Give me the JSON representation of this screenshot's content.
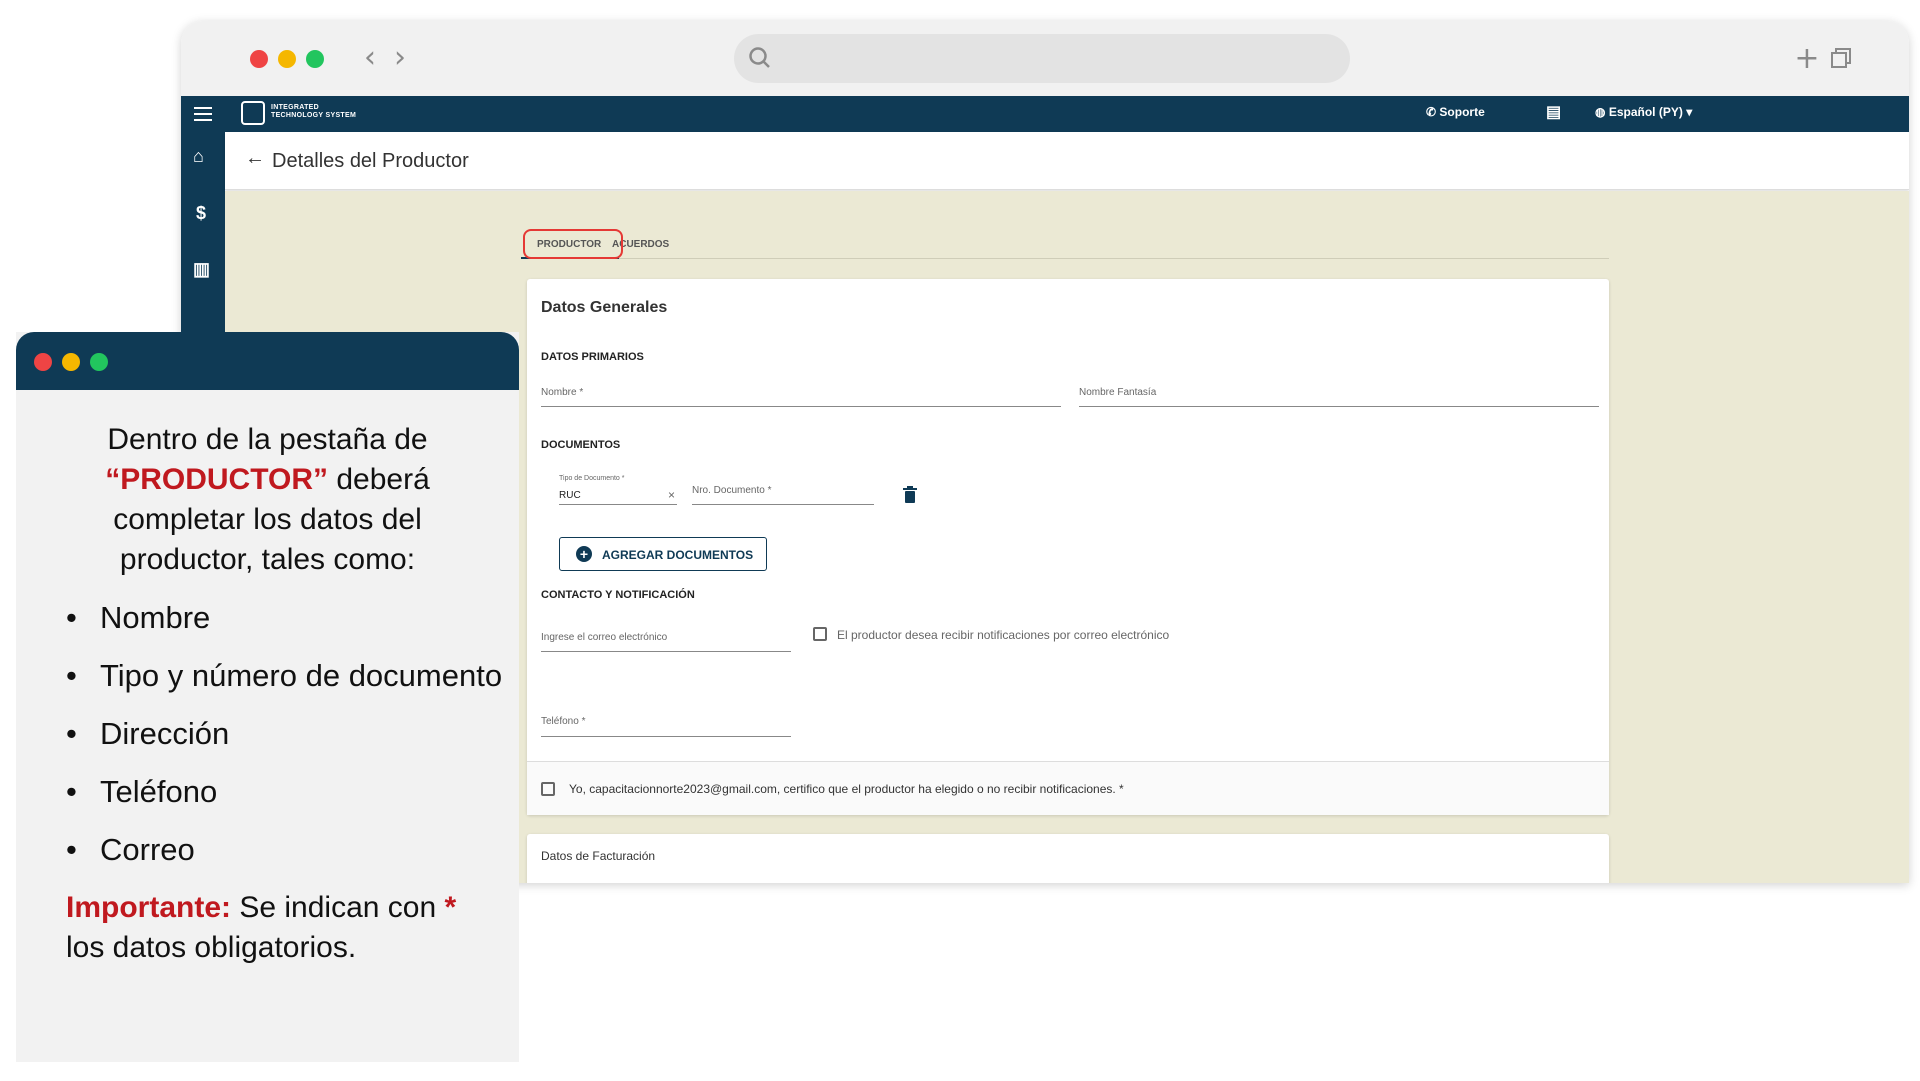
{
  "browser": {
    "traffic_lights": [
      "#ef4444",
      "#f5b700",
      "#22c55e"
    ],
    "nav_back": "‹",
    "nav_forward": "›",
    "new_tab": "+",
    "tab_overview_icon": "tabs-icon"
  },
  "appbar": {
    "brand_line1": "INTEGRATED",
    "brand_line2": "TECHNOLOGY SYSTEM",
    "support_label": "Soporte",
    "language_label": "Español (PY)",
    "background_color": "#0f3a55"
  },
  "rail": {
    "icons": [
      "menu-icon",
      "home-icon",
      "dollar-icon",
      "chart-icon"
    ]
  },
  "header": {
    "title": "Detalles del Productor"
  },
  "tabs": [
    {
      "label": "PRODUCTOR",
      "active": true
    },
    {
      "label": "ACUERDOS",
      "active": false
    }
  ],
  "card": {
    "title": "Datos Generales",
    "primary_section": "DATOS PRIMARIOS",
    "nombre_label": "Nombre *",
    "fantasia_label": "Nombre Fantasía",
    "documents_section": "DOCUMENTOS",
    "doc_type_label": "Tipo de Documento *",
    "doc_type_value": "RUC",
    "doc_number_label": "Nro. Documento *",
    "add_documents_label": "AGREGAR DOCUMENTOS",
    "contact_section": "CONTACTO Y NOTIFICACIÓN",
    "email_placeholder": "Ingrese el correo electrónico",
    "notify_checkbox_label": "El productor desea recibir notificaciones por correo electrónico",
    "phone_label": "Teléfono *",
    "certify_label": "Yo, capacitacionnorte2023@gmail.com, certifico que el productor ha elegido o no recibir notificaciones. *"
  },
  "billing": {
    "title": "Datos de Facturación"
  },
  "tutorial": {
    "intro_before": "Dentro de la pestaña de",
    "intro_highlight": "“PRODUCTOR”",
    "intro_after": " deberá completar los datos del productor, tales como:",
    "bullets": [
      "Nombre",
      "Tipo y número de documento",
      "Dirección",
      "Teléfono",
      "Correo"
    ],
    "important_label": "Importante:",
    "important_text_1": " Se indican con ",
    "important_star": "*",
    "important_text_2": " los datos obligatorios.",
    "accent_color": "#c0191f"
  }
}
